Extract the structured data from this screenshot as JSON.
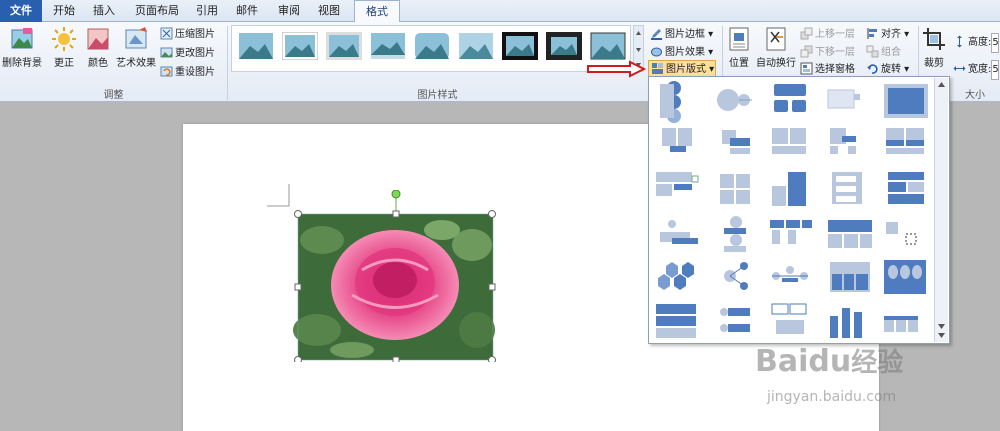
{
  "tabs": [
    {
      "label": "文件"
    },
    {
      "label": "开始"
    },
    {
      "label": "插入"
    },
    {
      "label": "页面布局"
    },
    {
      "label": "引用"
    },
    {
      "label": "邮件"
    },
    {
      "label": "审阅"
    },
    {
      "label": "视图"
    },
    {
      "label": "格式"
    }
  ],
  "adjust": {
    "remove_bg": "删除背景",
    "corrections": "更正",
    "color": "颜色",
    "artistic": "艺术效果",
    "compress": "压缩图片",
    "change": "更改图片",
    "reset": "重设图片",
    "group_label": "调整"
  },
  "styles": {
    "group_label": "图片样式",
    "border": "图片边框",
    "effects": "图片效果",
    "layout": "图片版式"
  },
  "arrange": {
    "position": "位置",
    "wrap": "自动换行",
    "forward": "上移一层",
    "backward": "下移一层",
    "selection_pane": "选择窗格",
    "align": "对齐",
    "group": "组合",
    "rotate": "旋转"
  },
  "size": {
    "crop": "裁剪",
    "height_label": "高度:",
    "width_label": "宽度:",
    "height_value": "5",
    "width_value": "5",
    "group_label": "大小"
  },
  "watermark": {
    "brand": "Bai",
    "du": "du",
    "jingyan": "经验",
    "url": "jingyan.baidu.com"
  },
  "colors": {
    "accent": "#2a5fb0",
    "layout_blue": "#4f7bbf",
    "arrow_red": "#d11b1b"
  }
}
